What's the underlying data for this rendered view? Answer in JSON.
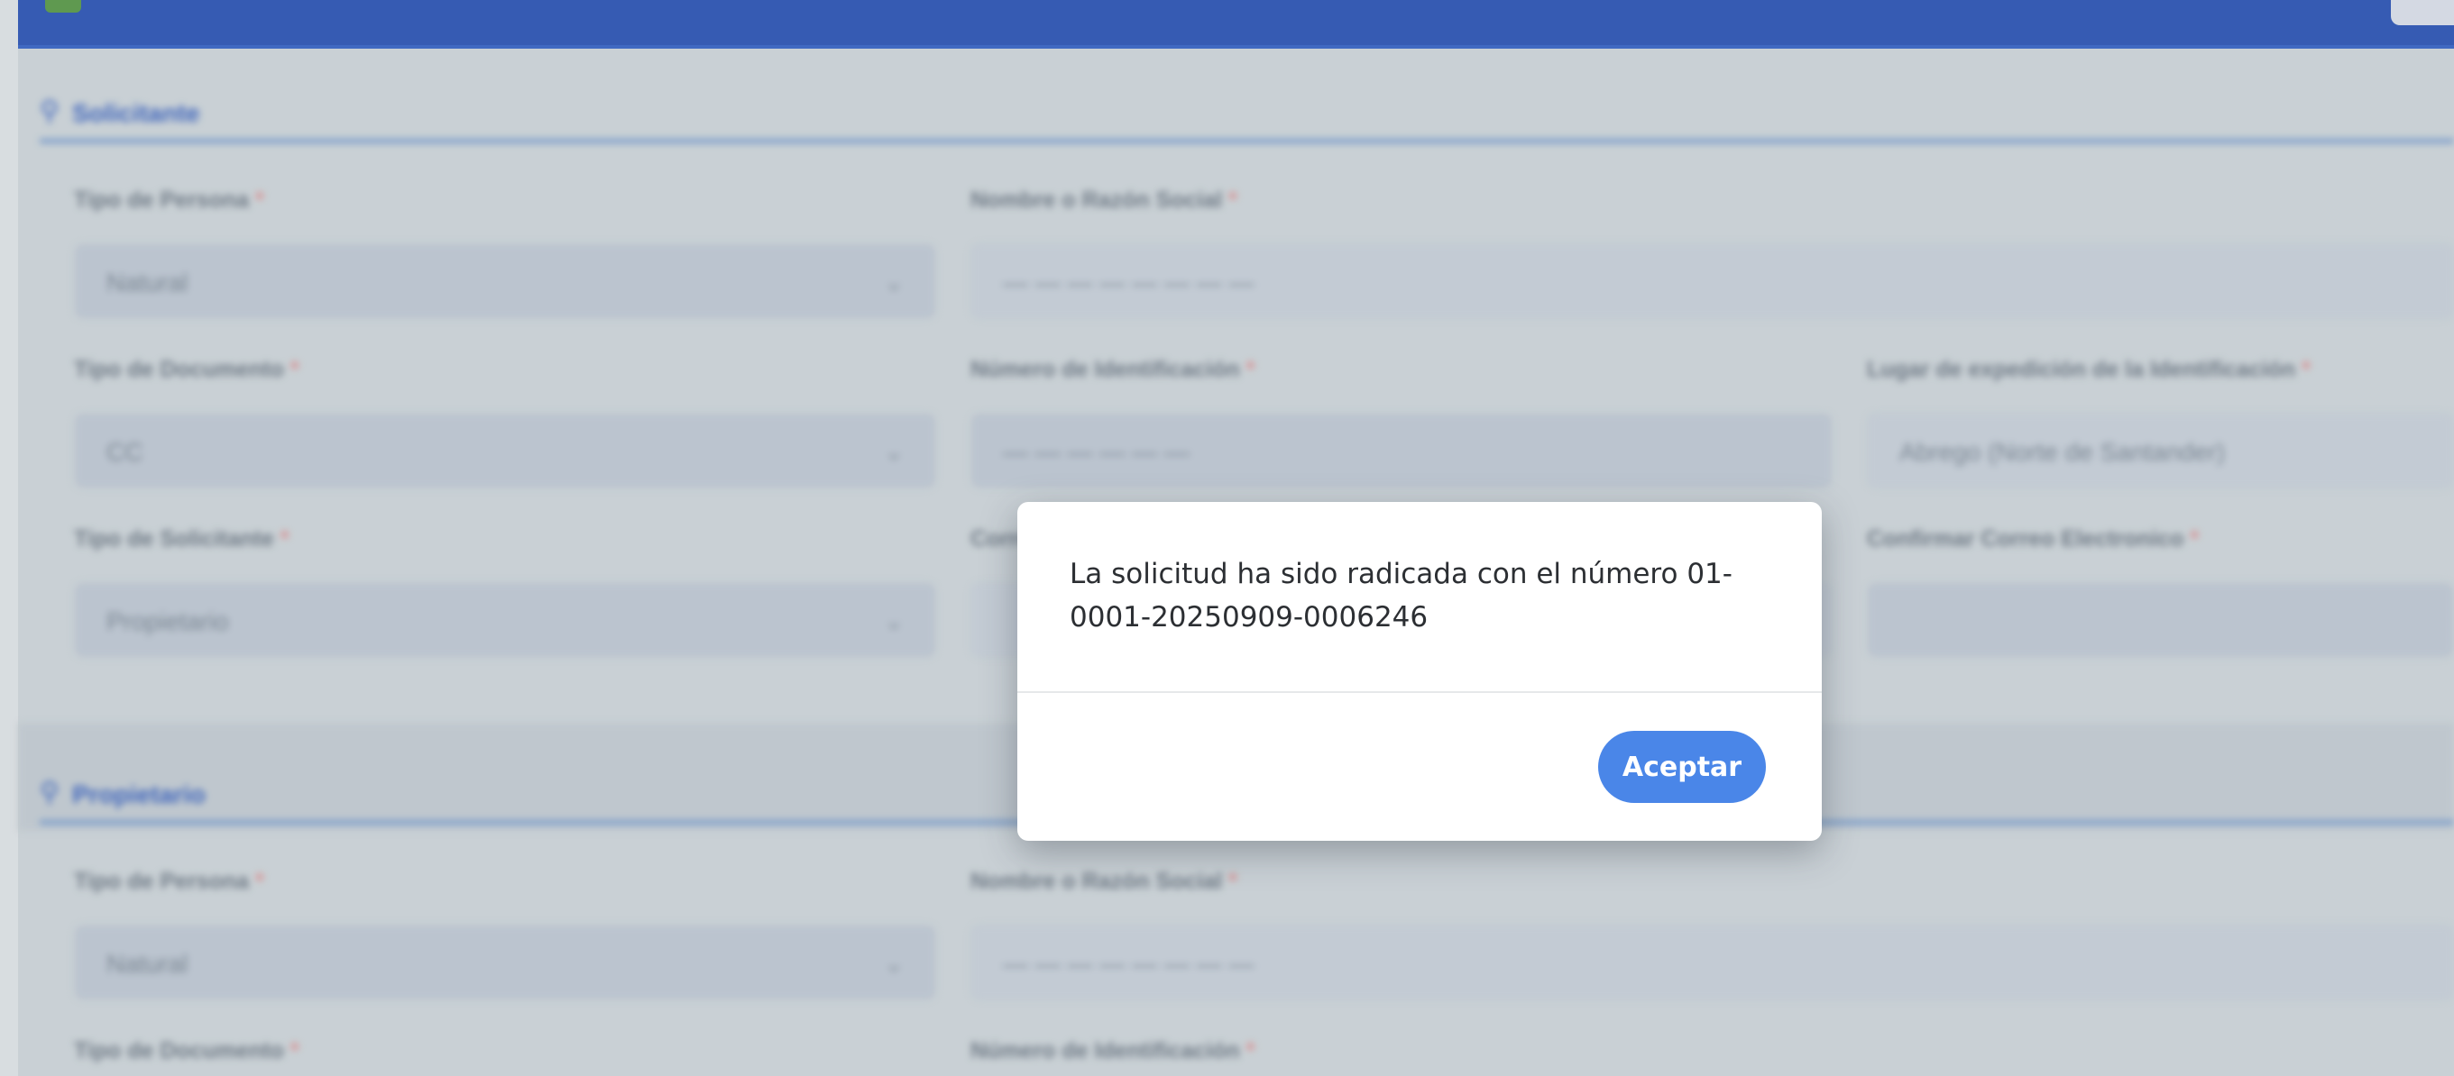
{
  "background": {
    "sections": [
      {
        "title": "Solicitante"
      },
      {
        "title": "Propietario"
      }
    ],
    "solicitante": {
      "tipo_persona_label": "Tipo de Persona",
      "tipo_persona_value": "Natural",
      "nombre_label": "Nombre o Razón Social",
      "tipo_documento_label": "Tipo de Documento",
      "tipo_documento_value": "CC",
      "numero_id_label": "Número de Identificación",
      "lugar_label": "Lugar de expedición de la Identificación",
      "lugar_value": "Abrego (Norte de Santander)",
      "tipo_solicitante_label": "Tipo de Solicitante",
      "tipo_solicitante_value": "Propietario",
      "correo_label": "Correo Electrónico",
      "confirmar_correo_label": "Confirmar Correo Electronico"
    },
    "propietario": {
      "tipo_persona_label": "Tipo de Persona",
      "tipo_persona_value": "Natural",
      "nombre_label": "Nombre o Razón Social",
      "tipo_documento_label": "Tipo de Documento",
      "numero_id_label": "Número de Identificación"
    },
    "required_mark": "*"
  },
  "dialog": {
    "message": "La solicitud ha sido radicada con el número 01-0001-20250909-0006246",
    "ok_label": "Aceptar",
    "accent_color": "#4a86e8"
  }
}
